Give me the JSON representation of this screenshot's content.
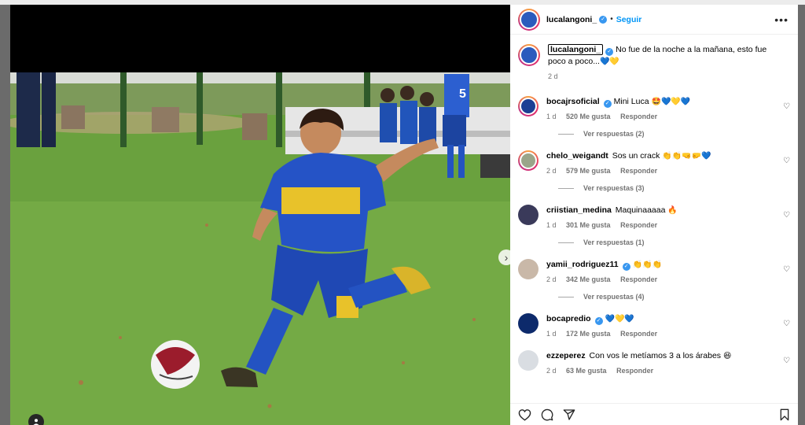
{
  "post": {
    "username": "lucalangoni_",
    "follow_label": "Seguir",
    "caption": "No fue de la noche a la mañana, esto fue poco a poco...",
    "caption_emoji": "💙💛",
    "caption_time": "2 d"
  },
  "comments": [
    {
      "user": "bocajrsoficial",
      "verified": true,
      "text": "Mini Luca",
      "emoji": "🤩💙💛💙",
      "time": "1 d",
      "likes": "520 Me gusta",
      "reply": "Responder",
      "replies": "Ver respuestas (2)",
      "avatar_color": "#1c3f94"
    },
    {
      "user": "chelo_weigandt",
      "verified": false,
      "text": "Sos un crack",
      "emoji": "👏👏🤜🤛💙",
      "time": "2 d",
      "likes": "579 Me gusta",
      "reply": "Responder",
      "replies": "Ver respuestas (3)",
      "avatar_color": "#9aa58a"
    },
    {
      "user": "criistian_medina",
      "verified": false,
      "text": "Maquinaaaaa",
      "emoji": "🔥",
      "time": "1 d",
      "likes": "301 Me gusta",
      "reply": "Responder",
      "replies": "Ver respuestas (1)",
      "avatar_color": "#3a3a5a"
    },
    {
      "user": "yamii_rodriguez11",
      "verified": true,
      "text": "",
      "emoji": "👏👏👏",
      "time": "2 d",
      "likes": "342 Me gusta",
      "reply": "Responder",
      "replies": "Ver respuestas (4)",
      "avatar_color": "#c9b8a8"
    },
    {
      "user": "bocapredio",
      "verified": true,
      "text": "",
      "emoji": "💙💛💙",
      "time": "1 d",
      "likes": "172 Me gusta",
      "reply": "Responder",
      "replies": "",
      "avatar_color": "#0d2a6b"
    },
    {
      "user": "ezzeperez",
      "verified": false,
      "text": "Con vos le metíamos 3 a los árabes",
      "emoji": "😆",
      "time": "2 d",
      "likes": "63 Me gusta",
      "reply": "Responder",
      "replies": "",
      "avatar_color": "#d9dde2"
    }
  ],
  "icons": {
    "like": "heart-icon",
    "comment": "comment-icon",
    "share": "share-icon",
    "save": "bookmark-icon",
    "more": "more-options-icon",
    "next": "chevron-right-icon",
    "tag": "user-tag-icon"
  },
  "colors": {
    "accent": "#0095f6",
    "verified": "#3897f0",
    "muted": "#737373"
  }
}
